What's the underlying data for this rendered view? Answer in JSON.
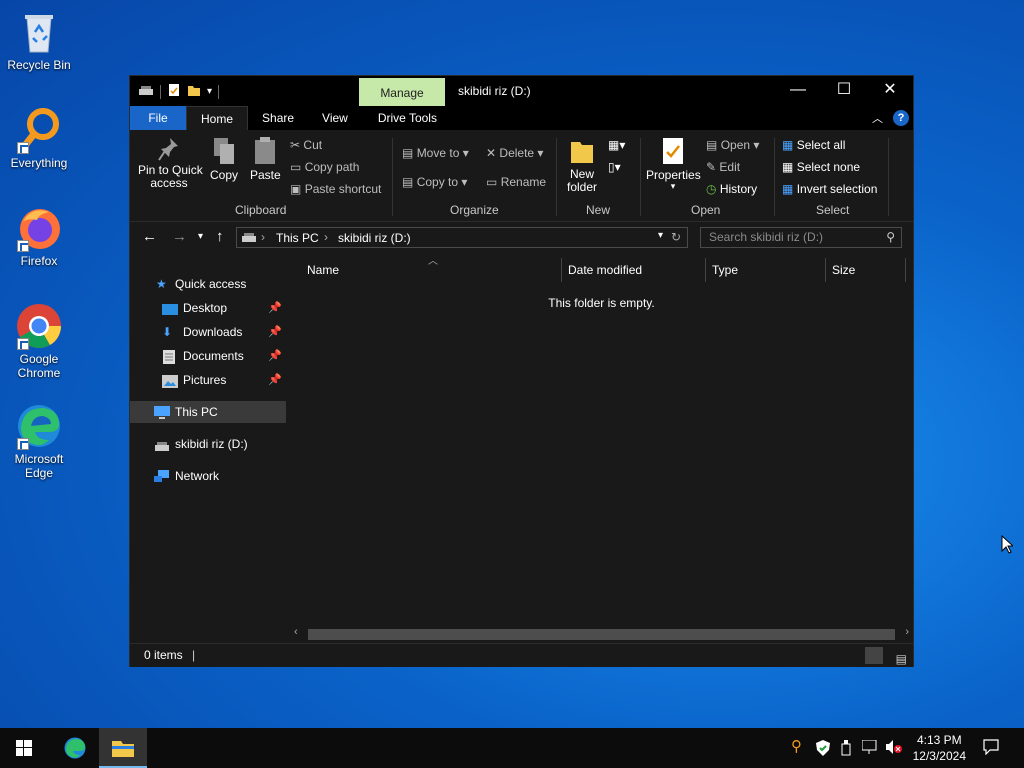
{
  "desktop": {
    "icons": [
      {
        "label": "Recycle Bin"
      },
      {
        "label": "Everything"
      },
      {
        "label": "Firefox"
      },
      {
        "label": "Google Chrome"
      },
      {
        "label": "Microsoft Edge"
      }
    ]
  },
  "window": {
    "title": "skibidi riz (D:)",
    "contextual_tab": "Manage",
    "tabs": [
      "File",
      "Home",
      "Share",
      "View",
      "Drive Tools"
    ],
    "active_tab": "Home"
  },
  "ribbon": {
    "clipboard": {
      "label": "Clipboard",
      "pin": "Pin to Quick access",
      "pin_l1": "Pin to Quick",
      "pin_l2": "access",
      "copy": "Copy",
      "paste": "Paste",
      "cut": "Cut",
      "copy_path": "Copy path",
      "paste_shortcut": "Paste shortcut"
    },
    "organize": {
      "label": "Organize",
      "move_to": "Move to",
      "copy_to": "Copy to",
      "delete": "Delete",
      "rename": "Rename"
    },
    "new": {
      "label": "New",
      "new_folder_l1": "New",
      "new_folder_l2": "folder"
    },
    "open": {
      "label": "Open",
      "properties": "Properties",
      "open": "Open",
      "edit": "Edit",
      "history": "History"
    },
    "select": {
      "label": "Select",
      "select_all": "Select all",
      "select_none": "Select none",
      "invert": "Invert selection"
    }
  },
  "address": {
    "crumbs": [
      "This PC",
      "skibidi riz (D:)"
    ],
    "search_placeholder": "Search skibidi riz (D:)"
  },
  "nav": {
    "quick_access": "Quick access",
    "desktop": "Desktop",
    "downloads": "Downloads",
    "documents": "Documents",
    "pictures": "Pictures",
    "this_pc": "This PC",
    "drive": "skibidi riz (D:)",
    "network": "Network"
  },
  "content": {
    "columns": [
      "Name",
      "Date modified",
      "Type",
      "Size"
    ],
    "empty_text": "This folder is empty."
  },
  "status": {
    "items": "0 items"
  },
  "taskbar": {
    "time": "4:13 PM",
    "date": "12/3/2024"
  },
  "colors": {
    "accent": "#1a66c8",
    "manage_tab": "#c6e9a9",
    "window_bg": "#191919"
  }
}
